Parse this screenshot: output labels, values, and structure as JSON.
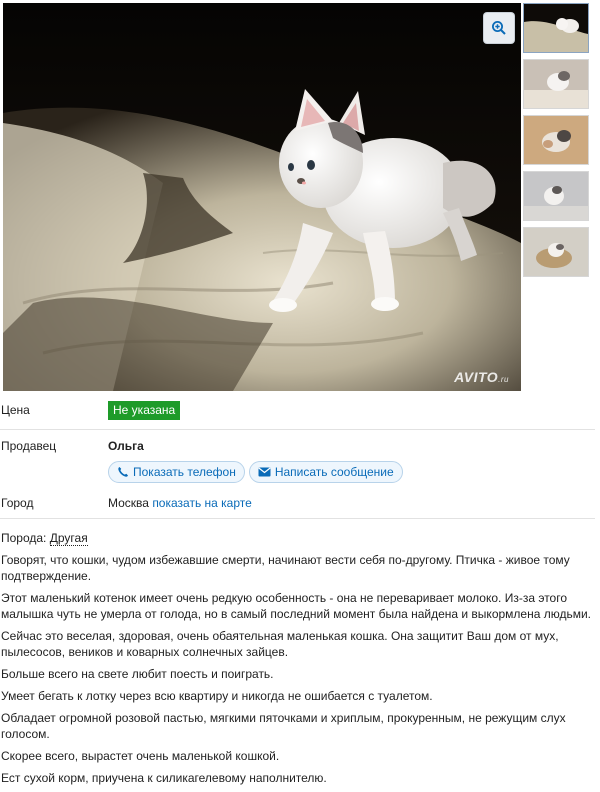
{
  "gallery": {
    "watermark_brand": "AVITO",
    "watermark_suffix": ".ru",
    "thumbnail_count": 5,
    "active_thumbnail": 1
  },
  "details": {
    "price_label": "Цена",
    "price_value": "Не указана",
    "seller_label": "Продавец",
    "seller_name": "Ольга",
    "show_phone_button": "Показать телефон",
    "write_message_button": "Написать сообщение",
    "city_label": "Город",
    "city_value": "Москва",
    "show_on_map_link": "показать на карте"
  },
  "description": {
    "breed_label": "Порода:",
    "breed_value": "Другая",
    "paragraphs": [
      "Говорят, что кошки, чудом избежавшие смерти, начинают вести себя по-другому. Птичка - живое тому подтверждение.",
      "Этот маленький котенок имеет очень редкую особенность - она не переваривает молоко. Из-за этого малышка чуть не умерла от голода, но в самый последний момент была найдена и выкормлена людьми.",
      "Сейчас это веселая, здоровая, очень обаятельная маленькая кошка. Она защитит Ваш дом от мух, пылесосов, веников и коварных солнечных зайцев.",
      "Больше всего на свете любит поесть и поиграть.",
      "Умеет бегать к лотку через всю квартиру и никогда не ошибается с туалетом.",
      "Обладает огромной розовой пастью, мягкими пяточками и хриплым, прокуренным, не режущим слух голосом.",
      "Скорее всего, вырастет очень маленькой кошкой.",
      "Ест сухой корм, приучена к силикагелевому наполнителю."
    ]
  },
  "colors": {
    "accent_link": "#0a6bb8",
    "price_badge": "#1e9b29"
  }
}
